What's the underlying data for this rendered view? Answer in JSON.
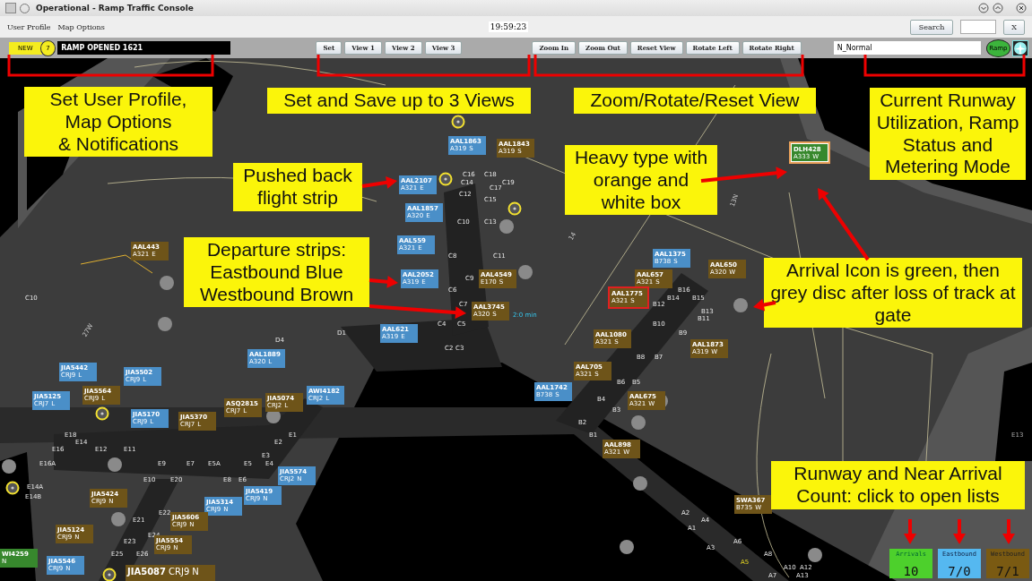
{
  "window": {
    "title": "Operational - Ramp Traffic Console"
  },
  "menu": [
    "User Profile",
    "Map Options"
  ],
  "clock": "19:59:23",
  "search": {
    "button": "Search",
    "close": "X"
  },
  "notification": {
    "badge": "NEW",
    "count": "7",
    "message": "RAMP OPENED 1621"
  },
  "view_buttons": [
    "Set",
    "View 1",
    "View 2",
    "View 3"
  ],
  "map_buttons": [
    "Zoom In",
    "Zoom Out",
    "Reset View",
    "Rotate Left",
    "Rotate Right"
  ],
  "runway_config": "N_Normal",
  "ramp_status": {
    "label": "Ramp",
    "on": true
  },
  "callouts": [
    "Set User Profile,\nMap Options\n& Notifications",
    "Set and Save up to 3 Views",
    "Zoom/Rotate/Reset View",
    "Current Runway\nUtilization, Ramp\nStatus and\nMetering Mode",
    "Pushed back\nflight strip",
    "Heavy type with\norange and\nwhite box",
    "Departure strips:\nEastbound Blue\nWestbound Brown",
    "Arrival Icon is green, then\ngrey disc after loss of track at\ngate",
    "Runway and Near Arrival\nCount: click to open lists"
  ],
  "strips": [
    {
      "callsign": "AAL1863",
      "aircraft": "A319",
      "wake": "S",
      "kind": "east",
      "heavy": false,
      "alert": false
    },
    {
      "callsign": "AAL1843",
      "aircraft": "A319",
      "wake": "S",
      "kind": "west",
      "heavy": false,
      "alert": false
    },
    {
      "callsign": "AAL2107",
      "aircraft": "A321",
      "wake": "E",
      "kind": "east",
      "heavy": false,
      "alert": false
    },
    {
      "callsign": "AAL1857",
      "aircraft": "A320",
      "wake": "E",
      "kind": "east",
      "heavy": false,
      "alert": false
    },
    {
      "callsign": "AAL559",
      "aircraft": "A321",
      "wake": "E",
      "kind": "east",
      "heavy": false,
      "alert": false
    },
    {
      "callsign": "AAL2052",
      "aircraft": "A319",
      "wake": "E",
      "kind": "east",
      "heavy": false,
      "alert": false
    },
    {
      "callsign": "AAL4549",
      "aircraft": "E170",
      "wake": "S",
      "kind": "west",
      "heavy": false,
      "alert": false
    },
    {
      "callsign": "AAL3745",
      "aircraft": "A320",
      "wake": "S",
      "kind": "west",
      "heavy": false,
      "alert": false
    },
    {
      "callsign": "AAL443",
      "aircraft": "A321",
      "wake": "E",
      "kind": "west",
      "heavy": false,
      "alert": false
    },
    {
      "callsign": "AAL621",
      "aircraft": "A319",
      "wake": "E",
      "kind": "east",
      "heavy": false,
      "alert": false
    },
    {
      "callsign": "AAL1375",
      "aircraft": "B738",
      "wake": "S",
      "kind": "east",
      "heavy": false,
      "alert": false
    },
    {
      "callsign": "AAL657",
      "aircraft": "A321",
      "wake": "S",
      "kind": "west",
      "heavy": false,
      "alert": false
    },
    {
      "callsign": "AAL1775",
      "aircraft": "A321",
      "wake": "S",
      "kind": "west",
      "heavy": false,
      "alert": true
    },
    {
      "callsign": "AAL650",
      "aircraft": "A320",
      "wake": "W",
      "kind": "west",
      "heavy": false,
      "alert": false
    },
    {
      "callsign": "AAL1080",
      "aircraft": "A321",
      "wake": "S",
      "kind": "west",
      "heavy": false,
      "alert": false
    },
    {
      "callsign": "AAL1873",
      "aircraft": "A319",
      "wake": "W",
      "kind": "west",
      "heavy": false,
      "alert": false
    },
    {
      "callsign": "AAL705",
      "aircraft": "A321",
      "wake": "S",
      "kind": "west",
      "heavy": false,
      "alert": false
    },
    {
      "callsign": "AAL1742",
      "aircraft": "B738",
      "wake": "S",
      "kind": "east",
      "heavy": false,
      "alert": false
    },
    {
      "callsign": "AAL675",
      "aircraft": "A321",
      "wake": "W",
      "kind": "west",
      "heavy": false,
      "alert": false
    },
    {
      "callsign": "AAL898",
      "aircraft": "A321",
      "wake": "W",
      "kind": "west",
      "heavy": false,
      "alert": false
    },
    {
      "callsign": "AAL1889",
      "aircraft": "A320",
      "wake": "L",
      "kind": "east",
      "heavy": false,
      "alert": false
    },
    {
      "callsign": "JIA5442",
      "aircraft": "CRJ9",
      "wake": "L",
      "kind": "east",
      "heavy": false,
      "alert": false
    },
    {
      "callsign": "JIA5125",
      "aircraft": "CRJ7",
      "wake": "L",
      "kind": "east",
      "heavy": false,
      "alert": false
    },
    {
      "callsign": "JIA5564",
      "aircraft": "CRJ9",
      "wake": "L",
      "kind": "west",
      "heavy": false,
      "alert": false
    },
    {
      "callsign": "JIA5502",
      "aircraft": "CRJ9",
      "wake": "L",
      "kind": "east",
      "heavy": false,
      "alert": false
    },
    {
      "callsign": "JIA5170",
      "aircraft": "CRJ9",
      "wake": "L",
      "kind": "east",
      "heavy": false,
      "alert": false
    },
    {
      "callsign": "JIA5370",
      "aircraft": "CRJ7",
      "wake": "L",
      "kind": "west",
      "heavy": false,
      "alert": false
    },
    {
      "callsign": "ASQ2815",
      "aircraft": "CRJ7",
      "wake": "L",
      "kind": "west",
      "heavy": false,
      "alert": false
    },
    {
      "callsign": "JIA5074",
      "aircraft": "CRJ2",
      "wake": "L",
      "kind": "west",
      "heavy": false,
      "alert": false
    },
    {
      "callsign": "AWI4182",
      "aircraft": "CRJ2",
      "wake": "L",
      "kind": "east",
      "heavy": false,
      "alert": false
    },
    {
      "callsign": "JIA5574",
      "aircraft": "CRJ2",
      "wake": "N",
      "kind": "east",
      "heavy": false,
      "alert": false
    },
    {
      "callsign": "JIA5419",
      "aircraft": "CRJ9",
      "wake": "N",
      "kind": "east",
      "heavy": false,
      "alert": false
    },
    {
      "callsign": "JIA5314",
      "aircraft": "CRJ9",
      "wake": "N",
      "kind": "east",
      "heavy": false,
      "alert": false
    },
    {
      "callsign": "JIA5424",
      "aircraft": "CRJ9",
      "wake": "N",
      "kind": "west",
      "heavy": false,
      "alert": false
    },
    {
      "callsign": "JIA5124",
      "aircraft": "CRJ9",
      "wake": "N",
      "kind": "west",
      "heavy": false,
      "alert": false
    },
    {
      "callsign": "JIA5606",
      "aircraft": "CRJ9",
      "wake": "N",
      "kind": "west",
      "heavy": false,
      "alert": false
    },
    {
      "callsign": "JIA5554",
      "aircraft": "CRJ9",
      "wake": "N",
      "kind": "west",
      "heavy": false,
      "alert": false
    },
    {
      "callsign": "SWA367",
      "aircraft": "B735",
      "wake": "W",
      "kind": "west",
      "heavy": false,
      "alert": false
    },
    {
      "callsign": "JIA5546",
      "aircraft": "CRJ9",
      "wake": "N",
      "kind": "east",
      "heavy": false,
      "alert": false
    },
    {
      "callsign": "JIA5087",
      "aircraft": "CRJ9",
      "wake": "N",
      "kind": "west",
      "heavy": false,
      "alert": false
    },
    {
      "callsign": "WI4259",
      "wake": "N",
      "kind": "arrival",
      "heavy": false,
      "alert": false
    },
    {
      "callsign": "DLH428",
      "aircraft": "A333",
      "wake": "W",
      "kind": "arrival",
      "heavy": true,
      "alert": false
    }
  ],
  "gates": [
    "C16",
    "C18",
    "C14",
    "C19",
    "C17",
    "C12",
    "C15",
    "C10",
    "C13",
    "C8",
    "C11",
    "C9",
    "C6",
    "B16",
    "C10",
    "B14",
    "B15",
    "C7",
    "B12",
    "B13",
    "B11",
    "C4",
    "C5",
    "B10",
    "D1",
    "B9",
    "D4",
    "C2",
    "C3",
    "B8",
    "B7",
    "B6",
    "B5",
    "B4",
    "B3",
    "B2",
    "E18",
    "E1",
    "B1",
    "E13",
    "E14",
    "E2",
    "E16",
    "E12",
    "E11",
    "E3",
    "E16A",
    "E9",
    "E7",
    "E5A",
    "E5",
    "E4",
    "E10",
    "E20",
    "E8",
    "E6",
    "E14A",
    "E14B",
    "E22",
    "A2",
    "E21",
    "A4",
    "A1",
    "E24",
    "E23",
    "A6",
    "A3",
    "E25",
    "E26",
    "A8",
    "A5",
    "A10",
    "A12",
    "A7",
    "A13"
  ],
  "runway_labels": [
    "27W",
    "13N",
    "14"
  ],
  "timer": "2:0 min",
  "counters": [
    {
      "label": "Arrivals",
      "value": "10",
      "kind": "arrivals"
    },
    {
      "label": "Eastbound",
      "value": "7/0",
      "kind": "east"
    },
    {
      "label": "Westbound",
      "value": "7/1",
      "kind": "west"
    }
  ]
}
